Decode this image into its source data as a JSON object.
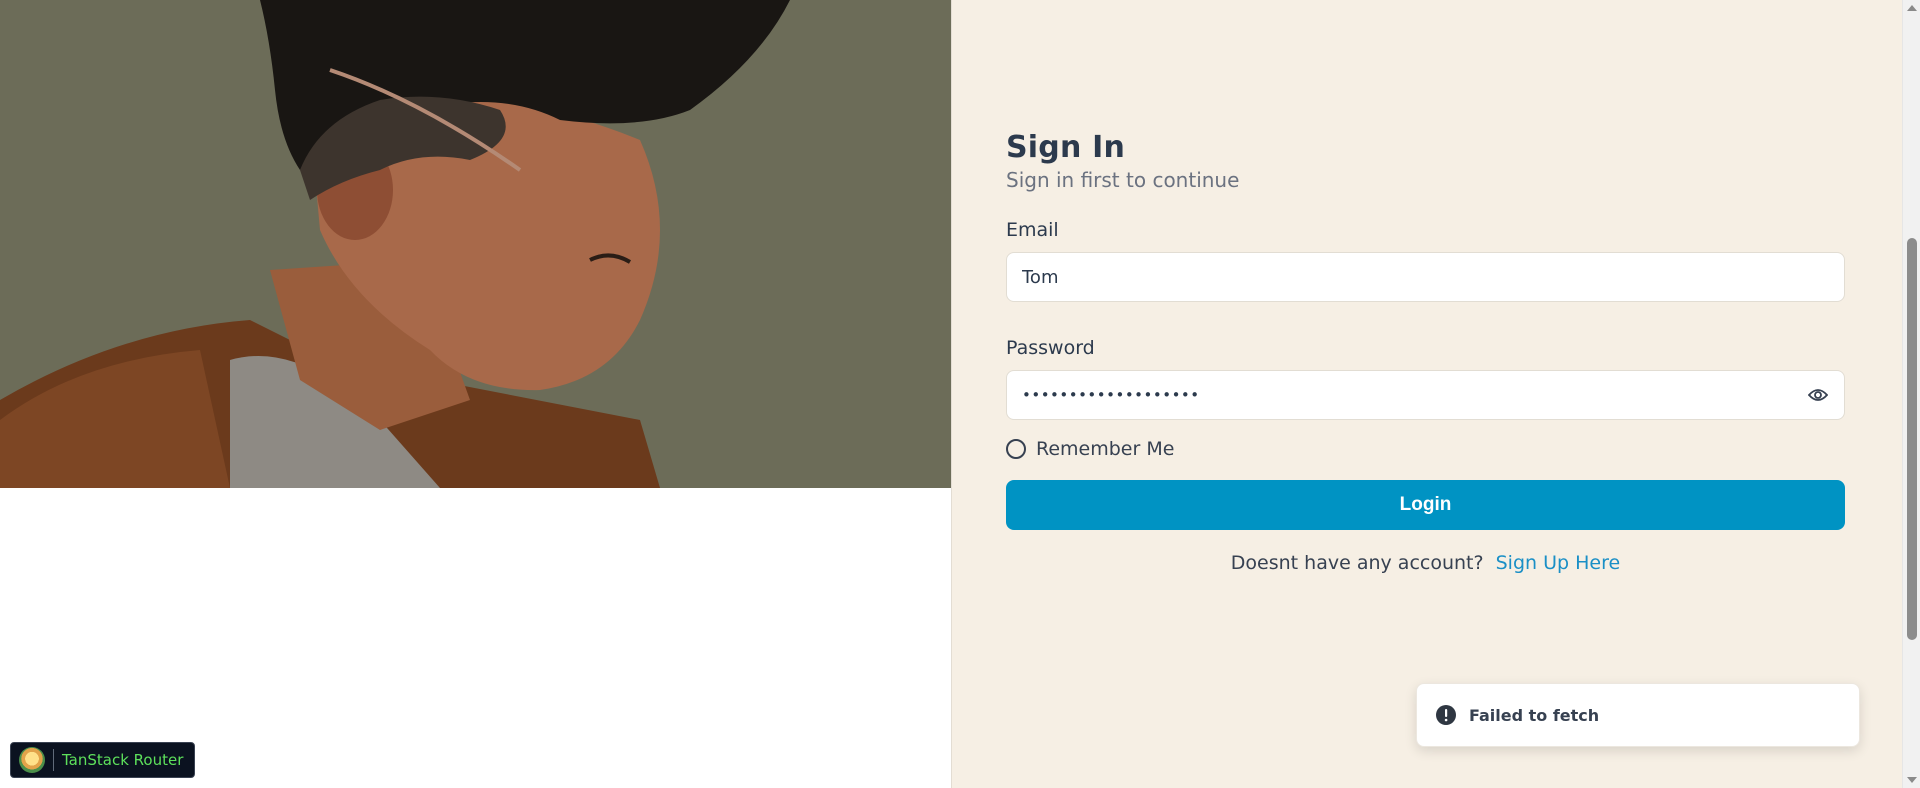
{
  "form": {
    "title": "Sign In",
    "subtitle": "Sign in first to continue",
    "email_label": "Email",
    "email_value": "Tom",
    "password_label": "Password",
    "password_value": "•••••••••••••••••••",
    "password_visibility_icon": "eye-icon",
    "remember_label": "Remember Me",
    "remember_checked": false,
    "login_label": "Login",
    "signup_prompt": "Doesnt have any account?",
    "signup_link": "Sign Up Here"
  },
  "toast": {
    "icon": "alert-circle-icon",
    "message": "Failed to fetch"
  },
  "devtools": {
    "label": "TanStack Router"
  },
  "colors": {
    "accent": "#0093c3",
    "link": "#1a8fc6",
    "panel_bg": "#f6efe4",
    "heading": "#2c3a4d",
    "devtools_text": "#5de05b"
  }
}
